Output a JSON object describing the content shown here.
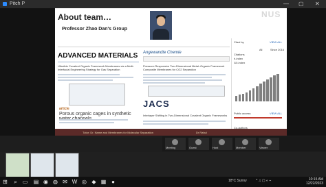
{
  "window": {
    "title": "Pitch P",
    "minimize": "—",
    "maximize": "▢",
    "close": "✕"
  },
  "slide": {
    "title": "About team…",
    "group": "Professor Zhao Dan's Group",
    "logo_text": "NUS",
    "journals": {
      "am": "ADVANCED MATERIALS",
      "ac": "Angewandte Chemie",
      "jacs": "JACS"
    },
    "articles": {
      "am_title": "Ultrathin Covalent Organic Framework Membranes via a Multi-Interfacial Engineering Strategy for Gas Separation",
      "ac_title": "Pressure-Responsive Two-Dimensional Metal–Organic Framework Composite Membranes for CO2 Separation",
      "jacs_title": "Interlayer Shifting in Two-Dimensional Covalent Organic Frameworks",
      "water_head": "article",
      "water_title": "Porous organic cages in synthetic water channels"
    },
    "side": {
      "cited_by": "Cited by",
      "view_all": "VIEW ALL",
      "all": "All",
      "since": "Since 2016",
      "citations": "Citations",
      "h_index": "h-index",
      "i10_index": "i10-index",
      "public_access": "Public access",
      "coauthors": "Co-authors"
    },
    "chart_data": {
      "type": "bar",
      "values": [
        10,
        12,
        14,
        16,
        20,
        24,
        28,
        32,
        36,
        40,
        44,
        48,
        50
      ]
    },
    "status_left": "Tutor: Dr. Name and Membranes for Molecular Separation",
    "status_mid": "Dr Rahul"
  },
  "participants": [
    "Meeting",
    "Guest",
    "Host",
    "Member",
    "Viewer"
  ],
  "taskbar": {
    "weather": "18°C Sunny",
    "time": "10:15 AM",
    "date": "12/22/2023"
  }
}
